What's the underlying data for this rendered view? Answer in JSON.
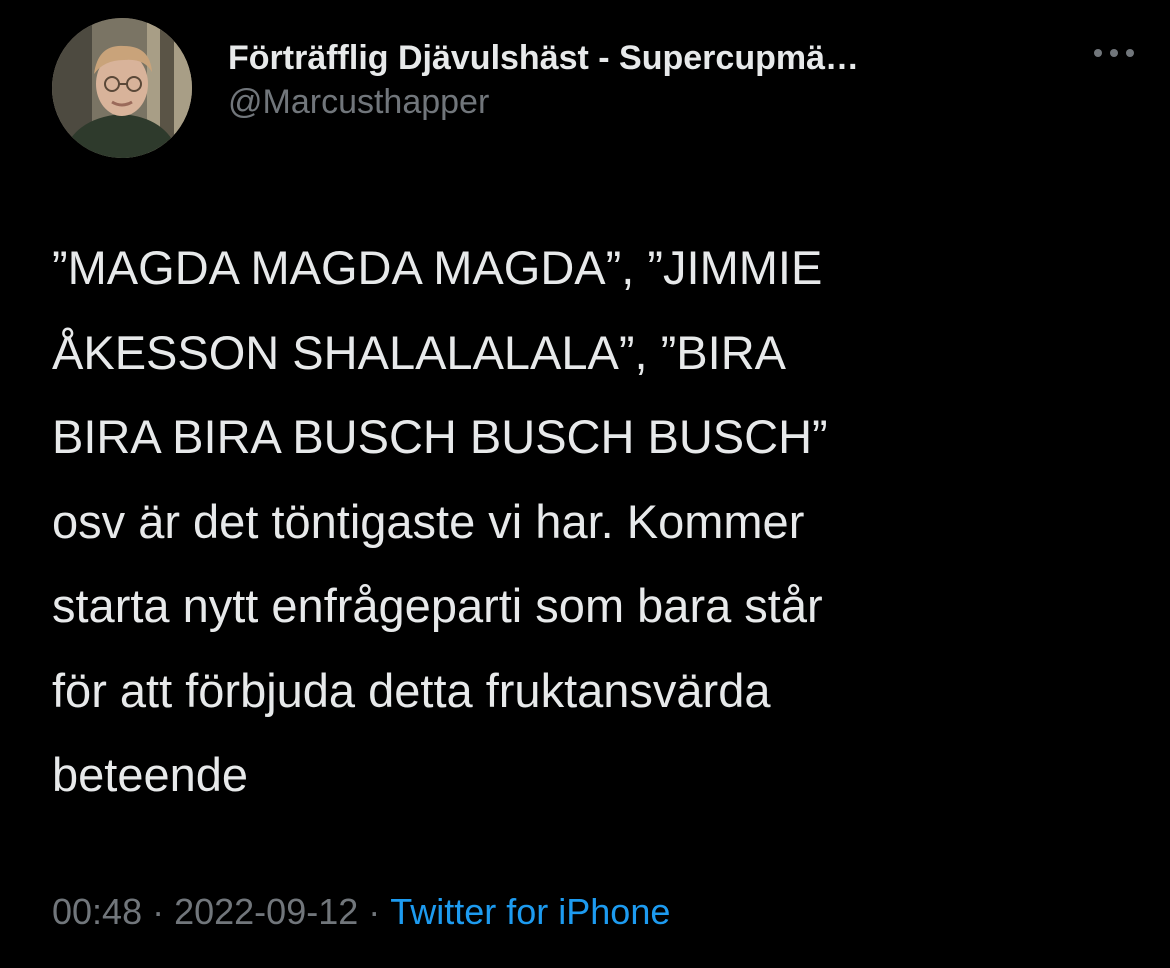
{
  "author": {
    "display_name": "Förträfflig Djävulshäst - Supercupmä…",
    "handle": "@Marcusthapper"
  },
  "more_menu": {
    "icon": "more-horizontal-icon"
  },
  "tweet": {
    "text": "”MAGDA MAGDA MAGDA”, ”JIMMIE\nÅKESSON SHALALALALA”, ”BIRA\nBIRA BIRA BUSCH BUSCH BUSCH”\nosv är det töntigaste vi har. Kommer\nstarta nytt enfrågeparti som bara står\nför att förbjuda detta fruktansvärda\nbeteende",
    "time": "00:48",
    "separator": "·",
    "date": "2022-09-12",
    "source": "Twitter for iPhone"
  },
  "colors": {
    "background": "#000000",
    "text": "#e7e9ea",
    "secondary_text": "#71767b",
    "link": "#1d9bf0"
  }
}
